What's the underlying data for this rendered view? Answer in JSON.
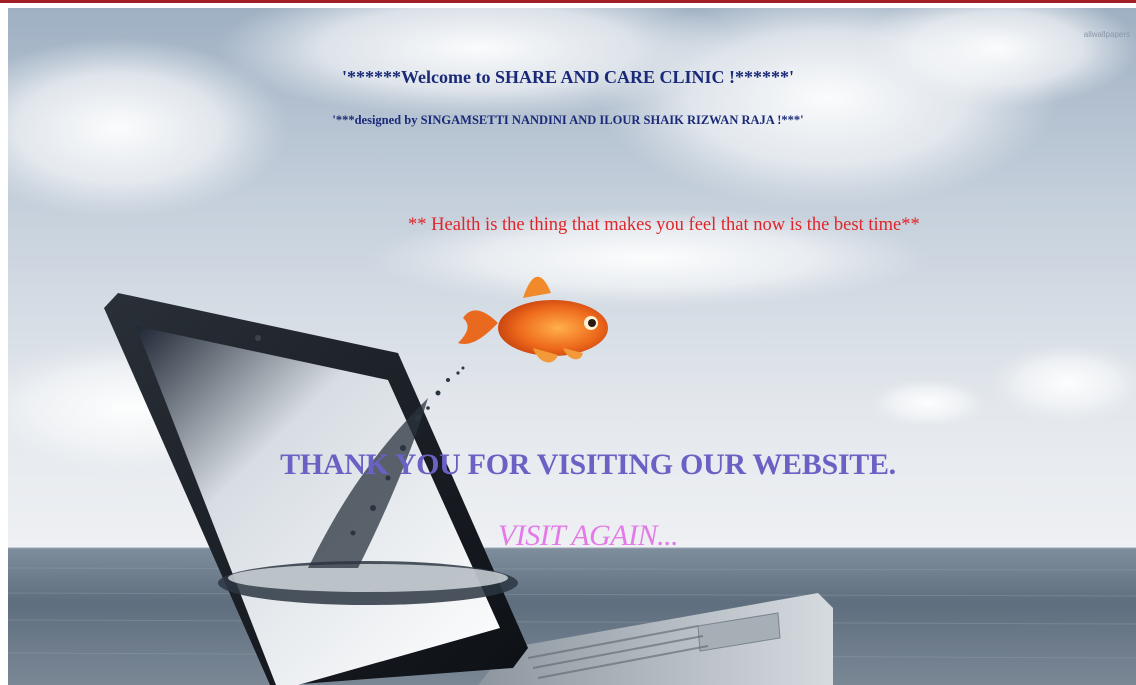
{
  "page": {
    "welcome": "'******Welcome to SHARE AND CARE CLINIC !******'",
    "designed_by": "'***designed by SINGAMSETTI NANDINI AND ILOUR SHAIK RIZWAN RAJA !***'",
    "quote": "** Health is the thing that makes you feel that now is the best time**",
    "thank_you": "THANK YOU FOR VISITING OUR WEBSITE.",
    "visit_again": "VISIT AGAIN..."
  },
  "watermark": "allwallpapers",
  "background": {
    "image_subject": "laptop-with-goldfish-jumping-over-sea",
    "icon_names": [
      "laptop-icon",
      "goldfish-icon",
      "water-splash-icon"
    ]
  },
  "colors": {
    "top_border": "#a01e24",
    "welcome_text": "#1a2a78",
    "quote_text": "#e0252a",
    "thanks_text": "#6a61c4",
    "visit_again_text": "#e47ae8",
    "sky": "#c9d3de",
    "sea": "#6e7c8a"
  }
}
